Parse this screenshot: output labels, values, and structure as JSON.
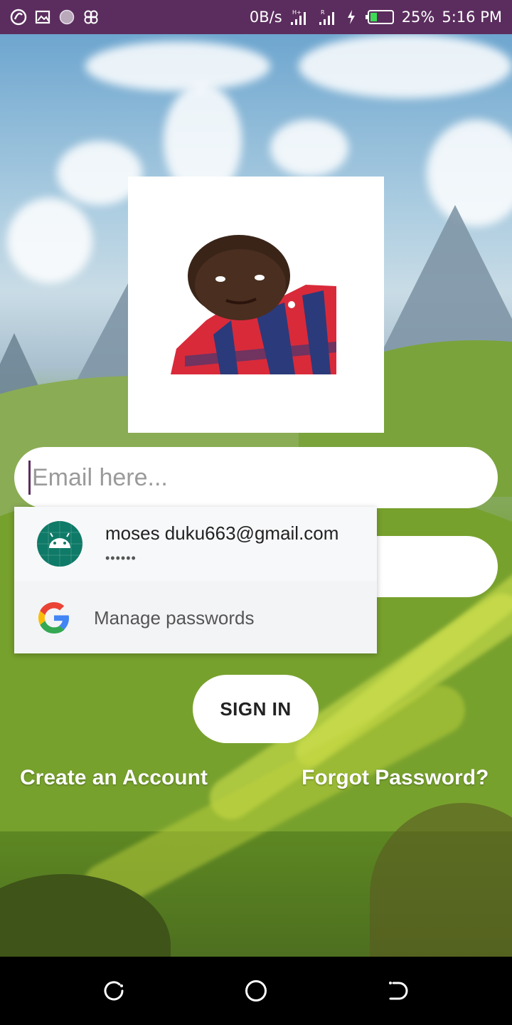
{
  "status_bar": {
    "net_speed": "0B/s",
    "battery_percent": "25%",
    "time": "5:16 PM",
    "bg_color": "#5b2d5e",
    "icons_left": [
      "app-icon",
      "image-icon",
      "circle-icon",
      "pinwheel-icon"
    ],
    "icons_right": [
      "signal-icon",
      "signal-icon",
      "charging-icon",
      "battery-icon"
    ]
  },
  "login": {
    "email_placeholder": "Email here...",
    "sign_in_label": "SIGN IN",
    "create_account_label": "Create an Account",
    "forgot_password_label": "Forgot Password?"
  },
  "autofill": {
    "account_email": "moses duku663@gmail.com",
    "password_mask": "••••••",
    "manage_label": "Manage passwords",
    "account_icon": "android-icon",
    "manage_icon": "google-icon"
  },
  "nav_bar": {
    "buttons": [
      "recent-apps-icon",
      "home-icon",
      "back-icon"
    ]
  }
}
